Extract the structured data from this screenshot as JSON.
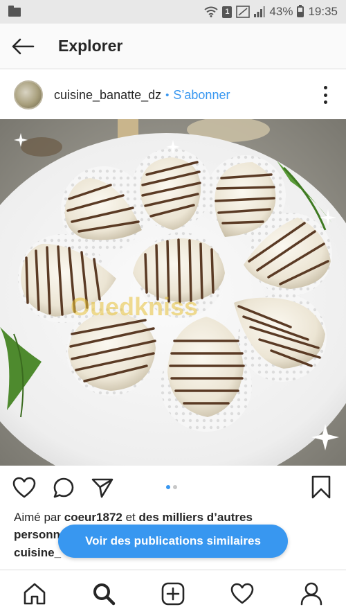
{
  "status_bar": {
    "battery_percent": "43%",
    "time": "19:35",
    "sim_label": "1"
  },
  "header": {
    "title": "Explorer"
  },
  "post": {
    "username": "cuisine_banatte_dz",
    "separator": "•",
    "subscribe_label": "S’abonner",
    "watermark": "Ouedkniss",
    "carousel": {
      "count": 2,
      "active_index": 0
    },
    "likes": {
      "prefix": "Aimé par ",
      "user": "coeur1872",
      "middle": " et ",
      "others": "des milliers d’autres"
    },
    "caption_line_1": "personn",
    "caption_line_2": "cuisine_",
    "similar_button_label": "Voir des publications similaires"
  },
  "colors": {
    "accent": "#3897f0",
    "text": "#262626",
    "cookie": "#f2ede2",
    "drizzle": "#5a3a24",
    "plate": "#ececec",
    "background": "#8b8a84"
  },
  "icons": {
    "back": "arrow-left-icon",
    "more": "vertical-dots-icon",
    "like": "heart-icon",
    "comment": "comment-bubble-icon",
    "share": "send-icon",
    "save": "bookmark-icon",
    "nav": [
      "home-icon",
      "search-icon",
      "add-post-icon",
      "activity-heart-icon",
      "profile-icon"
    ]
  }
}
